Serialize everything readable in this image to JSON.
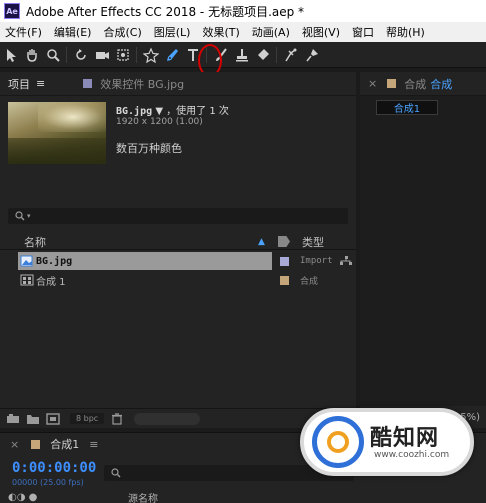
{
  "window": {
    "app_logo": "Ae",
    "title": "Adobe After Effects CC 2018 - 无标题项目.aep *"
  },
  "menu": [
    "文件(F)",
    "编辑(E)",
    "合成(C)",
    "图层(L)",
    "效果(T)",
    "动画(A)",
    "视图(V)",
    "窗口",
    "帮助(H)"
  ],
  "toolbar": {
    "tools": [
      "selection-tool",
      "hand-tool",
      "zoom-tool",
      "rotate-tool",
      "camera-tool",
      "pan-behind-tool",
      "shape-tool",
      "pen-tool",
      "type-tool",
      "brush-tool",
      "clone-stamp-tool",
      "eraser-tool",
      "roto-brush-tool",
      "puppet-tool"
    ],
    "highlighted_tool": "pen-tool",
    "highlight_color": "#d40000"
  },
  "project_panel": {
    "tab_label": "项目",
    "effects_tab_label": "效果控件 BG.jpg",
    "file_name": "BG.jpg",
    "used_text": "，使用了 1 次",
    "dimensions": "1920 x 1200 (1.00)",
    "colors": "数百万种颜色",
    "columns": {
      "name": "名称",
      "type": "类型"
    },
    "items": [
      {
        "name": "BG.jpg",
        "type": "Import",
        "label_color": "#a9a9d8",
        "selected": true
      },
      {
        "name": "合成 1",
        "type": "合成",
        "label_color": "#c4a67a",
        "selected": false
      }
    ],
    "bpc": "8 bpc"
  },
  "comp_panel": {
    "tab_label": "合成",
    "tab_link": "合成",
    "comp_name": "合成1",
    "zoom": "(38.5%)"
  },
  "timeline": {
    "tab_label": "合成1",
    "timecode": "0:00:00:00",
    "frames": "00000 (25.00 fps)",
    "source_name_header": "源名称"
  },
  "watermark": {
    "title": "酷知网",
    "url": "www.coozhi.com"
  },
  "accent_color": "#4aa3ff"
}
